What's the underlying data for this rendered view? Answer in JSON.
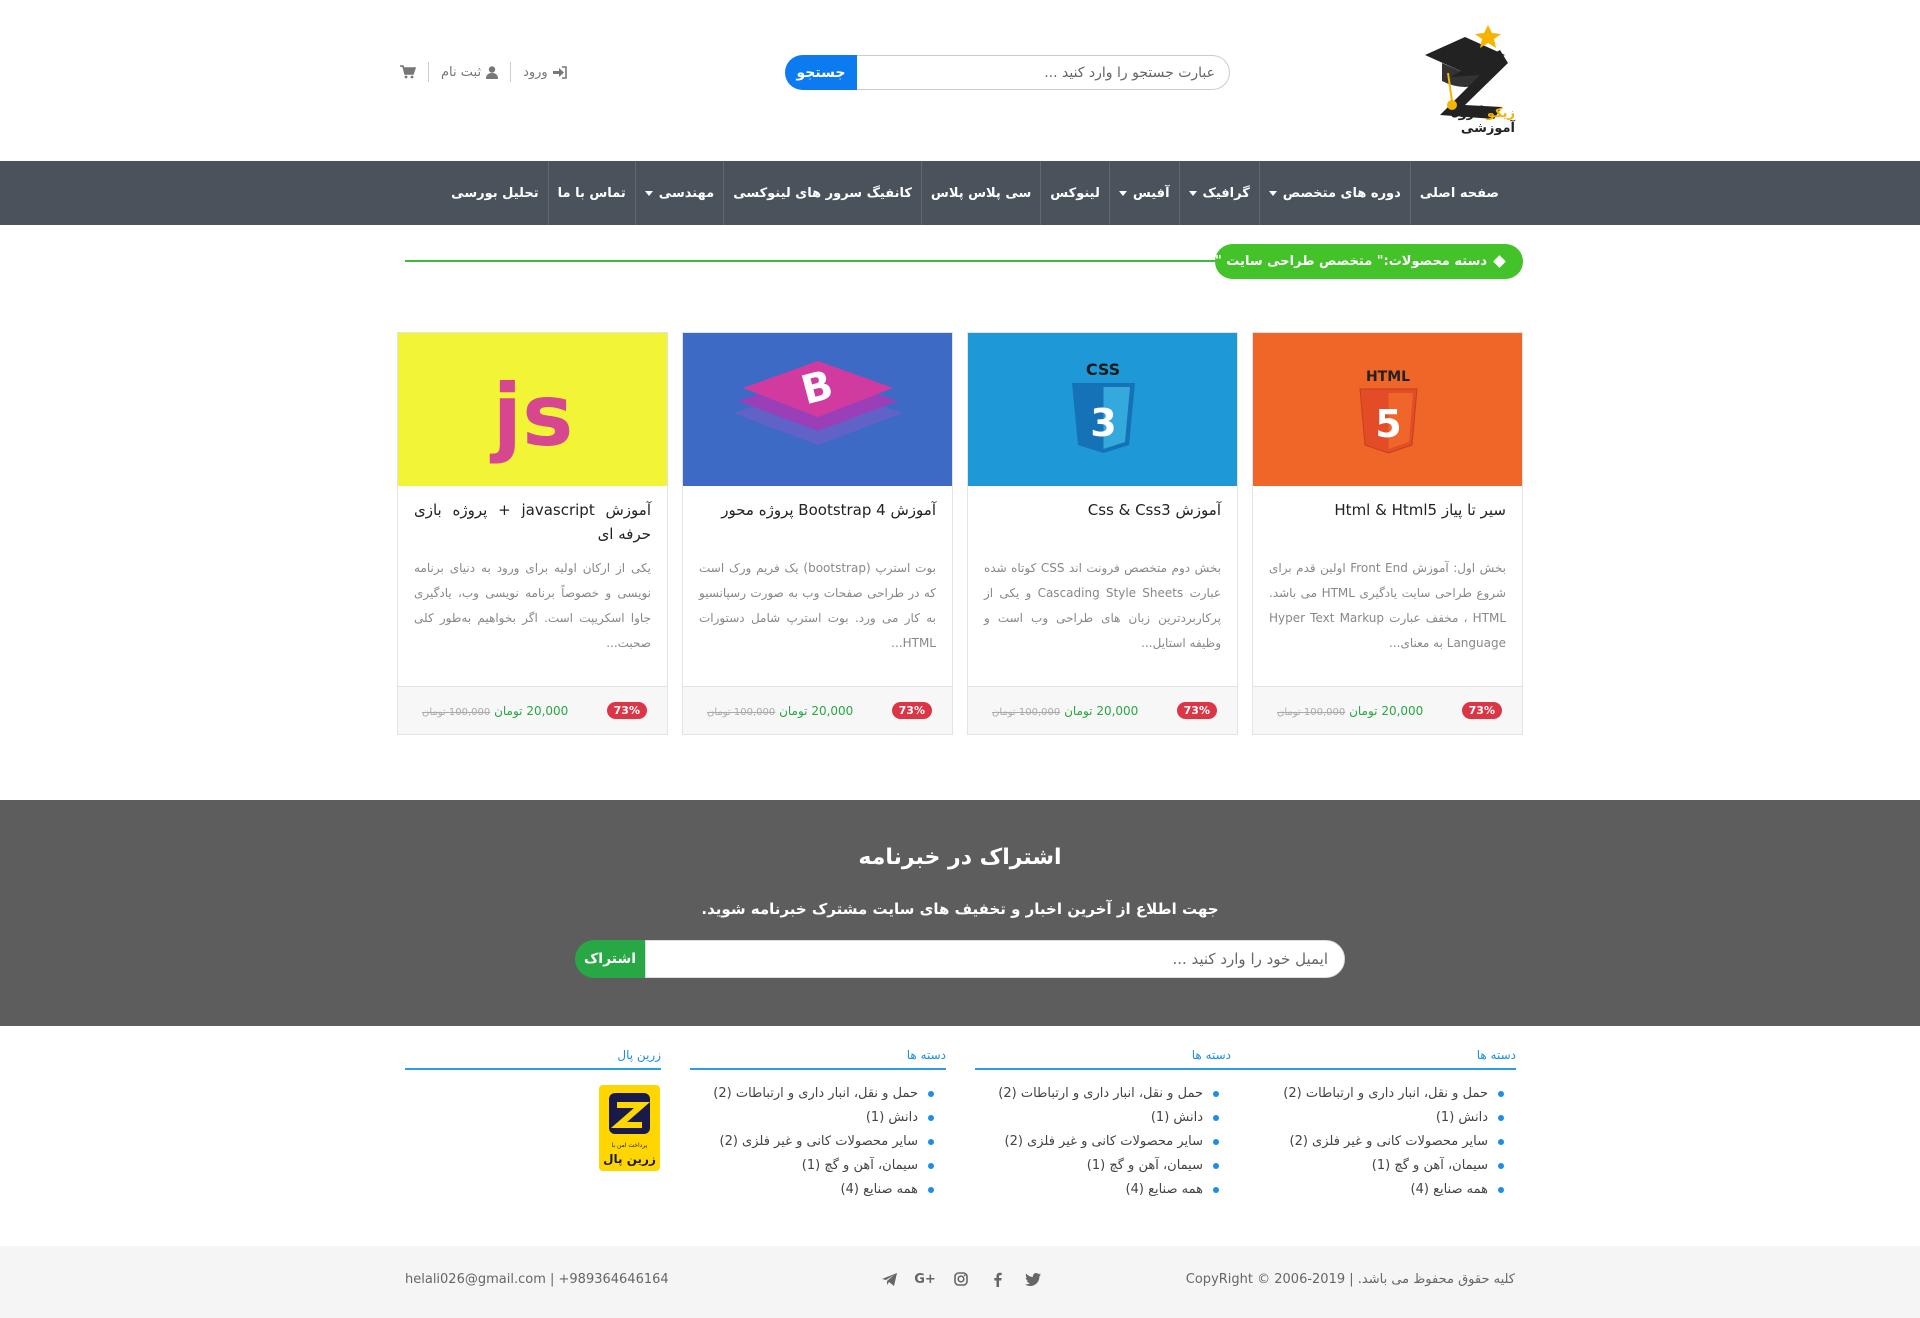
{
  "header": {
    "logo_text_a": "گروه آموزشی",
    "logo_text_b": "زیکو",
    "search_placeholder": "عبارت جستجو را وارد کنید ...",
    "search_button": "جستجو",
    "login": "ورود",
    "register": "ثبت نام"
  },
  "nav": {
    "items": [
      {
        "label": "صفحه اصلی"
      },
      {
        "label": "دوره های متخصص"
      },
      {
        "label": "گرافیک"
      },
      {
        "label": "آفیس"
      },
      {
        "label": "لینوکس"
      },
      {
        "label": "سی پلاس پلاس"
      },
      {
        "label": "کانفیگ سرور های لینوکسی"
      },
      {
        "label": "مهندسی"
      },
      {
        "label": "تماس با ما"
      },
      {
        "label": "تحلیل بورسی"
      }
    ]
  },
  "category": {
    "label": "دسته محصولات:\" متخصص طراحی سایت \""
  },
  "products": [
    {
      "title": "سیر تا پیاز Html & Html5",
      "desc": "بخش اول: آموزش Front End اولین قدم برای شروع طراحی سایت یادگیری HTML می باشد. HTML ، مخفف عبارت Hyper Text Markup Language به معنای...",
      "badge": "73%",
      "old_price": "100,000 تومان",
      "price": "20,000 تومان",
      "img_label": "HTML",
      "img_num": "5"
    },
    {
      "title": "آموزش Css & Css3",
      "desc": "بخش دوم متخصص فرونت اند CSS کوتاه شده عبارت Cascading Style Sheets و یکی از پرکاربردترین زبان های طراحی وب است و وظیفه استایل...",
      "badge": "73%",
      "old_price": "100,000 تومان",
      "price": "20,000 تومان",
      "img_label": "CSS",
      "img_num": "3"
    },
    {
      "title": "آموزش Bootstrap 4 پروژه محور",
      "desc": "بوت استرپ (bootstrap) یک فریم ورک است که در طراحی صفحات وب به صورت رسپانسیو به کار می ورد. بوت استرپ شامل دستورات HTML...",
      "badge": "73%",
      "old_price": "100,000 تومان",
      "price": "20,000 تومان",
      "img_label": "B"
    },
    {
      "title": "آموزش javascript + پروژه بازی حرفه ای",
      "desc": "یکی از ارکان اولیه برای ورود به دنیای برنامه نویسی و خصوصاً برنامه نویسی وب، یادگیری جاوا اسکریپت است. اگر بخواهیم به‌طور کلی صحبت...",
      "badge": "73%",
      "old_price": "100,000 تومان",
      "price": "20,000 تومان",
      "img_label": "js"
    }
  ],
  "newsletter": {
    "title": "اشتراک در خبرنامه",
    "subtitle": "جهت اطلاع از آخرین اخبار و تخفیف های سایت مشترک خبرنامه شوید.",
    "placeholder": "ایمیل خود را وارد کنید ...",
    "button": "اشتراک"
  },
  "footer": {
    "col_title": "دسته ها",
    "links": [
      "حمل و نقل، انبار داری و ارتباطات (2)",
      "دانش (1)",
      "سایر محصولات کانی و غیر فلزی (2)",
      "سیمان، آهن و گچ (1)",
      "همه صنایع (4)"
    ],
    "zarinpal_title": "زرین پال",
    "zarinpal_small": "پرداخت امن با",
    "zarinpal_name": "زرین پال",
    "copyright": "کلیه حقوق محفوظ می باشد. | CopyRight © 2006-2019",
    "email": "helali026@gmail.com",
    "phone": "+989364646164"
  },
  "colors": {
    "nav_bg": "#4a525c",
    "accent_blue": "#0d7bf0",
    "accent_green": "#43c22a",
    "newsletter_bg": "#5d5d5d",
    "badge_red": "#dc3545"
  }
}
